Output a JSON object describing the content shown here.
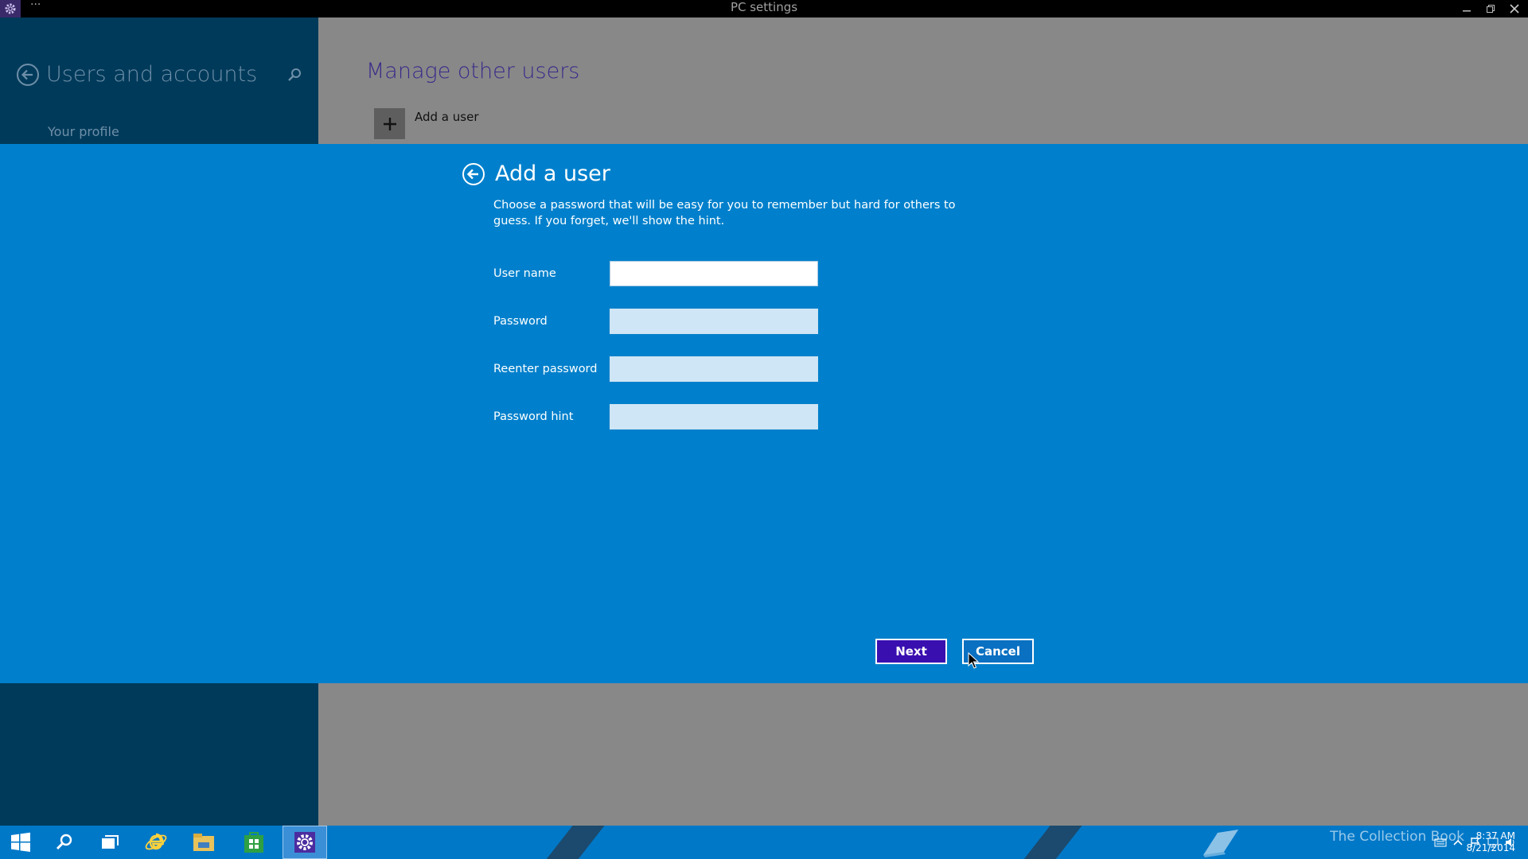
{
  "window": {
    "title": "PC settings",
    "menu_dots": "···"
  },
  "left_pane": {
    "title": "Users and accounts",
    "items": [
      {
        "label": "Your profile"
      }
    ]
  },
  "right_pane": {
    "title": "Manage other users",
    "add_user_label": "Add a user"
  },
  "dialog": {
    "title": "Add a user",
    "description": "Choose a password that will be easy for you to remember but hard for others to guess. If you forget, we'll show the hint.",
    "fields": [
      {
        "label": "User name",
        "value": ""
      },
      {
        "label": "Password",
        "value": ""
      },
      {
        "label": "Reenter password",
        "value": ""
      },
      {
        "label": "Password hint",
        "value": ""
      }
    ],
    "next_label": "Next",
    "cancel_label": "Cancel"
  },
  "taskbar": {
    "watermark": "The Collection Book",
    "time": "8:37 AM",
    "date": "8/21/2014"
  },
  "colors": {
    "dialog_bg": "#0080cc",
    "left_pane_bg": "#003a5a",
    "accent_purple": "#3a0fb0"
  }
}
